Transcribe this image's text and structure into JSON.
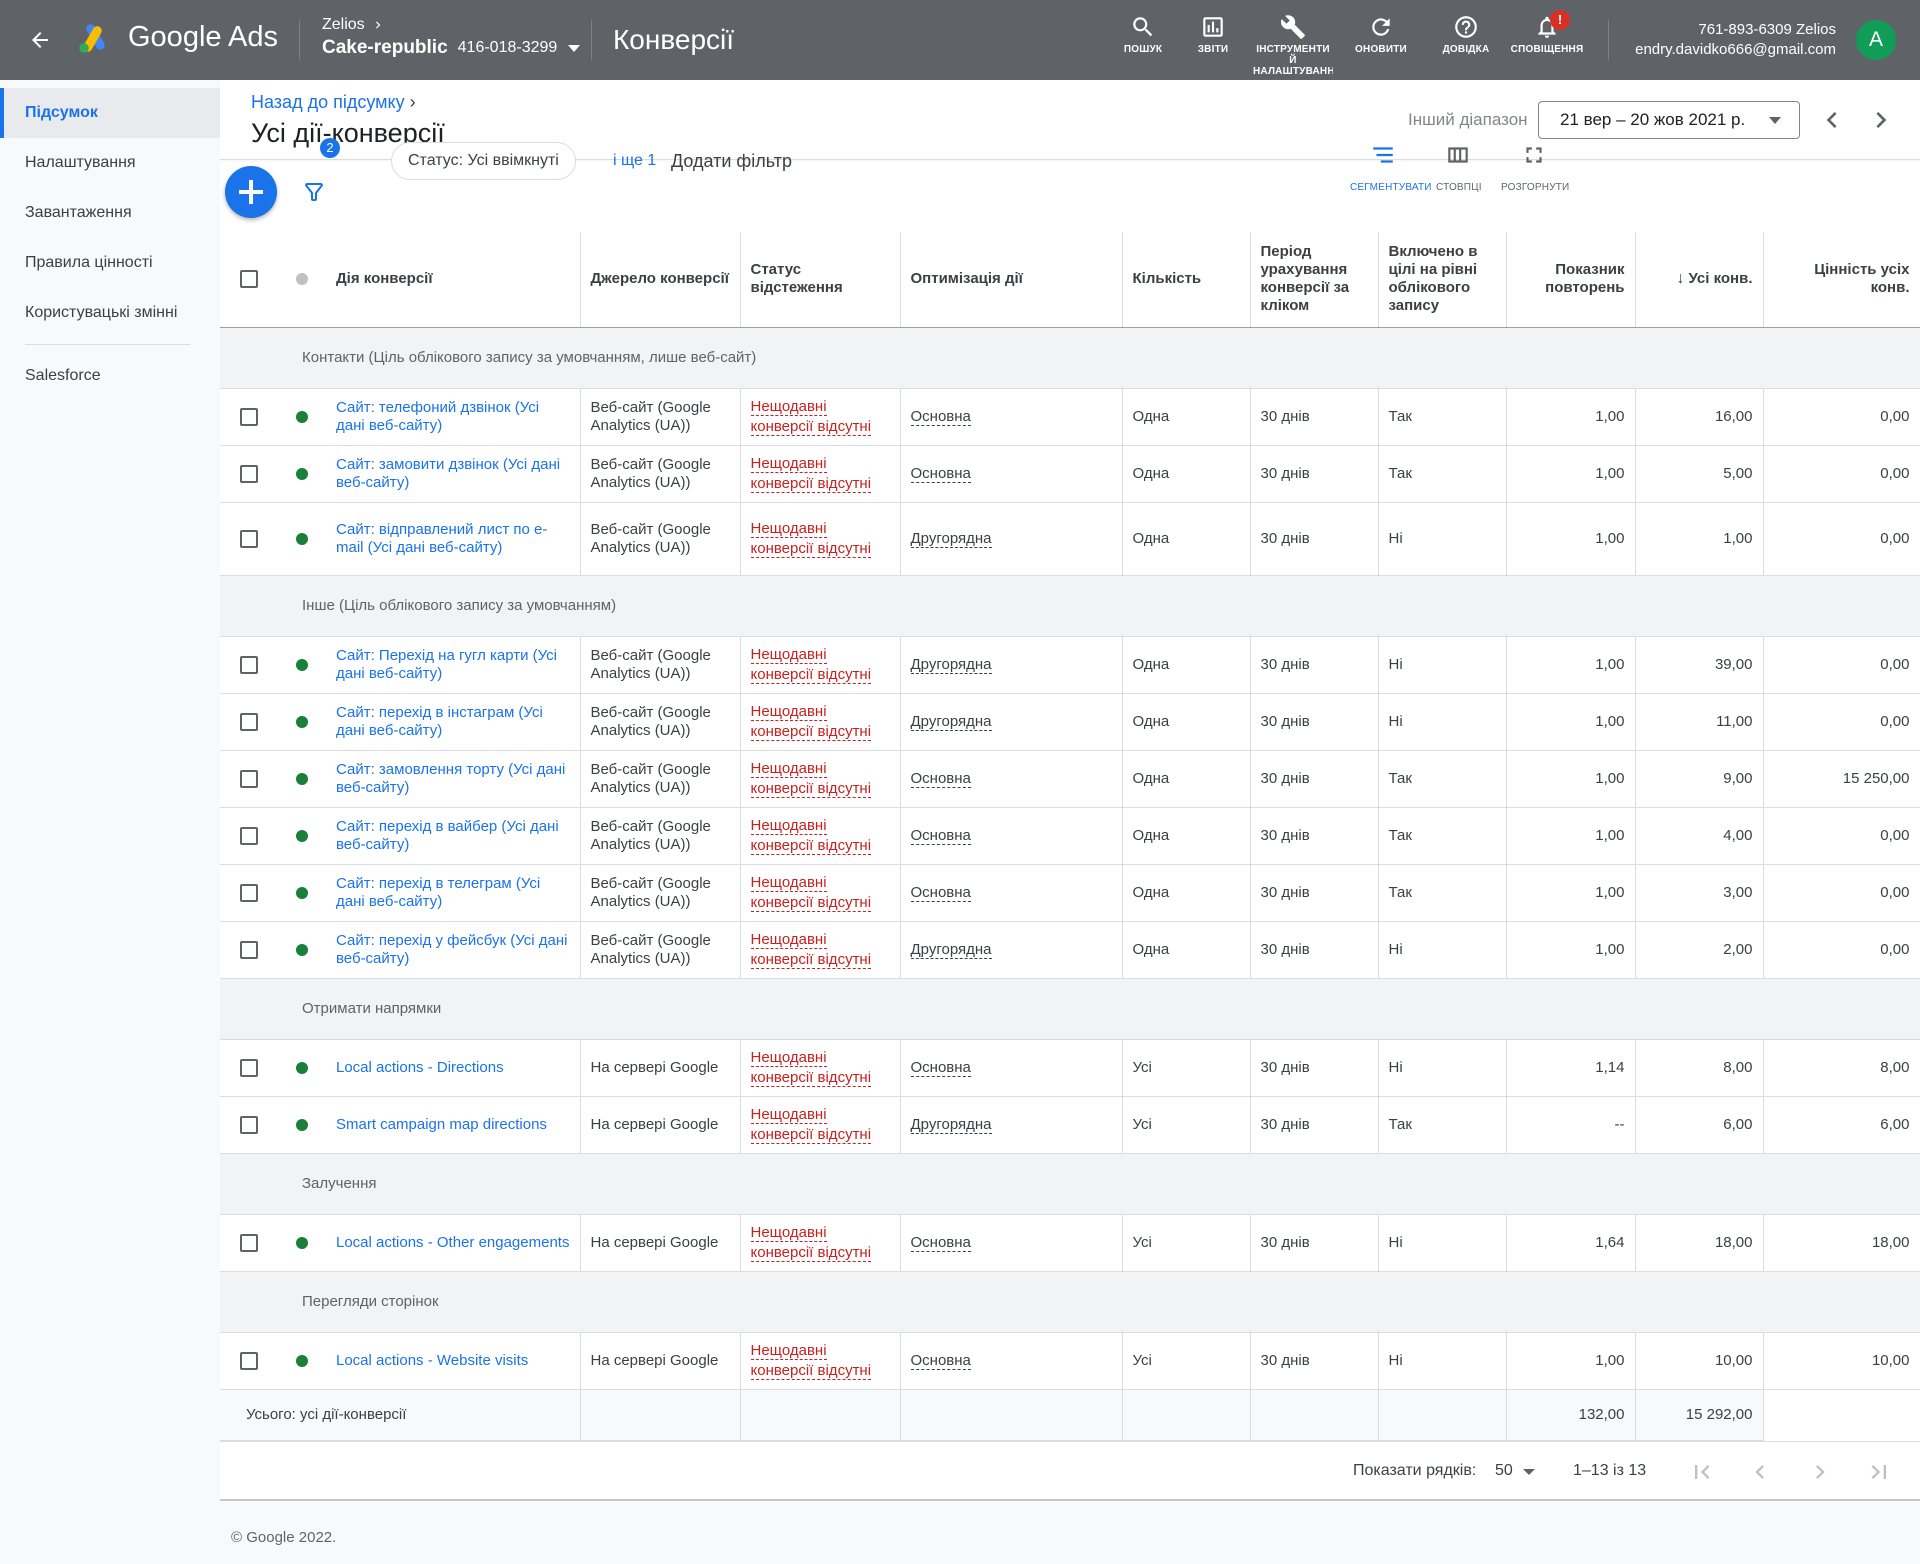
{
  "header": {
    "brand": "Google Ads",
    "account_name": "Zelios",
    "account_sub": "Cake-republic",
    "account_id": "416-018-3299",
    "page_title": "Конверсії",
    "tools": [
      {
        "label": "ПОШУК",
        "icon": "search-icon"
      },
      {
        "label": "ЗВІТИ",
        "icon": "reports-icon"
      },
      {
        "label": "ІНСТРУМЕНТИ Й НАЛАШТУВАННЯ",
        "icon": "wrench-icon"
      },
      {
        "label": "ОНОВИТИ",
        "icon": "refresh-icon"
      },
      {
        "label": "ДОВІДКА",
        "icon": "help-icon"
      },
      {
        "label": "СПОВІЩЕННЯ",
        "icon": "bell-icon",
        "badge": "!"
      }
    ],
    "user_line1": "761-893-6309 Zelios",
    "user_line2": "endry.davidko666@gmail.com",
    "avatar_letter": "A",
    "colors": {
      "bar": "#5f6368",
      "accent": "#1a73e8",
      "avatar": "#0f9d58"
    }
  },
  "sidebar": {
    "items": [
      {
        "label": "Підсумок",
        "active": true
      },
      {
        "label": "Налаштування"
      },
      {
        "label": "Завантаження"
      },
      {
        "label": "Правила цінності"
      },
      {
        "label": "Користувацькі змінні"
      },
      {
        "label": "Salesforce"
      }
    ]
  },
  "page": {
    "breadcrumb": "Назад до підсумку",
    "title": "Усі дії-конверсії",
    "range_label": "Інший діапазон",
    "date_range": "21 вер – 20 жов 2021 р."
  },
  "toolbar": {
    "filter_count": "2",
    "status_chip": "Статус: Усі ввімкнуті",
    "more_link": "і ще 1",
    "add_filter": "Додати фільтр",
    "segment": "СЕГМЕНТУВАТИ",
    "columns": "СТОВПЦІ",
    "expand": "РОЗГОРНУТИ"
  },
  "table": {
    "headers": [
      "Дія конверсії",
      "Джерело конверсії",
      "Статус відстеження",
      "Оптимізація дії",
      "Кількість",
      "Період урахування конверсії за кліком",
      "Включено в цілі на рівні облікового запису",
      "Показник повторень",
      "Усі конв.",
      "Цінність усіх конв."
    ],
    "groups": [
      {
        "label": "Контакти (Ціль облікового запису за умовчанням, лише веб-сайт)",
        "rows": [
          {
            "name": "Сайт: телефоний дзвінок (Усі дані веб-сайту)",
            "source": "Веб-сайт (Google Analytics (UA))",
            "status": "Нещодавні конверсії відсутні",
            "opt": "Основна",
            "count": "Одна",
            "period": "30 днів",
            "incl": "Так",
            "rep": "1,00",
            "conv": "16,00",
            "value": "0,00"
          },
          {
            "name": "Сайт: замовити дзвінок (Усі дані веб-сайту)",
            "source": "Веб-сайт (Google Analytics (UA))",
            "status": "Нещодавні конверсії відсутні",
            "opt": "Основна",
            "count": "Одна",
            "period": "30 днів",
            "incl": "Так",
            "rep": "1,00",
            "conv": "5,00",
            "value": "0,00"
          },
          {
            "name": "Сайт: відправлений лист по e-mail (Усі дані веб-сайту)",
            "source": "Веб-сайт (Google Analytics (UA))",
            "status": "Нещодавні конверсії відсутні",
            "opt": "Другорядна",
            "count": "Одна",
            "period": "30 днів",
            "incl": "Ні",
            "rep": "1,00",
            "conv": "1,00",
            "value": "0,00",
            "tall": true
          }
        ]
      },
      {
        "label": "Інше (Ціль облікового запису за умовчанням)",
        "rows": [
          {
            "name": "Сайт: Перехід на гугл карти (Усі дані веб-сайту)",
            "source": "Веб-сайт (Google Analytics (UA))",
            "status": "Нещодавні конверсії відсутні",
            "opt": "Другорядна",
            "count": "Одна",
            "period": "30 днів",
            "incl": "Ні",
            "rep": "1,00",
            "conv": "39,00",
            "value": "0,00"
          },
          {
            "name": "Сайт: перехід в інстаграм (Усі дані веб-сайту)",
            "source": "Веб-сайт (Google Analytics (UA))",
            "status": "Нещодавні конверсії відсутні",
            "opt": "Другорядна",
            "count": "Одна",
            "period": "30 днів",
            "incl": "Ні",
            "rep": "1,00",
            "conv": "11,00",
            "value": "0,00"
          },
          {
            "name": "Сайт: замовлення торту (Усі дані веб-сайту)",
            "source": "Веб-сайт (Google Analytics (UA))",
            "status": "Нещодавні конверсії відсутні",
            "opt": "Основна",
            "count": "Одна",
            "period": "30 днів",
            "incl": "Так",
            "rep": "1,00",
            "conv": "9,00",
            "value": "15 250,00"
          },
          {
            "name": "Сайт: перехід в вайбер (Усі дані веб-сайту)",
            "source": "Веб-сайт (Google Analytics (UA))",
            "status": "Нещодавні конверсії відсутні",
            "opt": "Основна",
            "count": "Одна",
            "period": "30 днів",
            "incl": "Так",
            "rep": "1,00",
            "conv": "4,00",
            "value": "0,00"
          },
          {
            "name": "Сайт: перехід в телеграм (Усі дані веб-сайту)",
            "source": "Веб-сайт (Google Analytics (UA))",
            "status": "Нещодавні конверсії відсутні",
            "opt": "Основна",
            "count": "Одна",
            "period": "30 днів",
            "incl": "Так",
            "rep": "1,00",
            "conv": "3,00",
            "value": "0,00"
          },
          {
            "name": "Сайт: перехід у фейсбук (Усі дані веб-сайту)",
            "source": "Веб-сайт (Google Analytics (UA))",
            "status": "Нещодавні конверсії відсутні",
            "opt": "Другорядна",
            "count": "Одна",
            "period": "30 днів",
            "incl": "Ні",
            "rep": "1,00",
            "conv": "2,00",
            "value": "0,00"
          }
        ]
      },
      {
        "label": "Отримати напрямки",
        "rows": [
          {
            "name": "Local actions - Directions",
            "source": "На сервері Google",
            "status": "Нещодавні конверсії відсутні",
            "opt": "Основна",
            "count": "Усі",
            "period": "30 днів",
            "incl": "Ні",
            "rep": "1,14",
            "conv": "8,00",
            "value": "8,00"
          },
          {
            "name": "Smart campaign map directions",
            "source": "На сервері Google",
            "status": "Нещодавні конверсії відсутні",
            "opt": "Другорядна",
            "count": "Усі",
            "period": "30 днів",
            "incl": "Так",
            "rep": "--",
            "conv": "6,00",
            "value": "6,00"
          }
        ]
      },
      {
        "label": "Залучення",
        "rows": [
          {
            "name": "Local actions - Other engagements",
            "source": "На сервері Google",
            "status": "Нещодавні конверсії відсутні",
            "opt": "Основна",
            "count": "Усі",
            "period": "30 днів",
            "incl": "Ні",
            "rep": "1,64",
            "conv": "18,00",
            "value": "18,00"
          }
        ]
      },
      {
        "label": "Перегляди сторінок",
        "rows": [
          {
            "name": "Local actions - Website visits",
            "source": "На сервері Google",
            "status": "Нещодавні конверсії відсутні",
            "opt": "Основна",
            "count": "Усі",
            "period": "30 днів",
            "incl": "Ні",
            "rep": "1,00",
            "conv": "10,00",
            "value": "10,00"
          }
        ]
      }
    ],
    "total_label": "Усього: усі дії-конверсії",
    "total_conv": "132,00",
    "total_value": "15 292,00"
  },
  "pager": {
    "rows_label": "Показати рядків:",
    "rows_value": "50",
    "range": "1–13 із 13"
  },
  "footer": "© Google 2022."
}
